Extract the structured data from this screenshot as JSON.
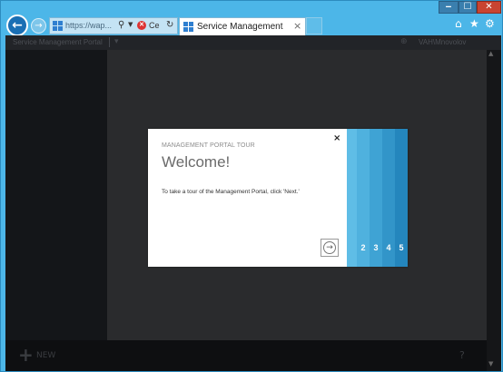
{
  "window": {
    "controls": {
      "minimize": "‒",
      "maximize": "☐",
      "close": "✕"
    }
  },
  "browser": {
    "address_url": "https://wap...",
    "cert_error_label": "Ce",
    "tab_title": "Service Management",
    "tab_close": "×",
    "icons": [
      "home-icon",
      "star-icon",
      "gear-icon"
    ]
  },
  "portal": {
    "app_title": "Service Management Portal",
    "version_glyph": "▾",
    "user_label": "VAH\\Mnovolov",
    "new_label": "NEW",
    "help_glyph": "?"
  },
  "dialog": {
    "kicker": "MANAGEMENT PORTAL TOUR",
    "title": "Welcome!",
    "body": "To take a tour of the Management Portal, click 'Next.'",
    "close_glyph": "×",
    "steps": [
      "2",
      "3",
      "4",
      "5"
    ],
    "step_colors": [
      "#4fb1de",
      "#3fa3d4",
      "#3295c9",
      "#2486bd"
    ],
    "first_step_color": "#5fbde6"
  },
  "colors": {
    "browser_chrome": "#4cb6e8",
    "portal_bg": "#1b1d21",
    "dialog_bg": "#ffffff"
  }
}
